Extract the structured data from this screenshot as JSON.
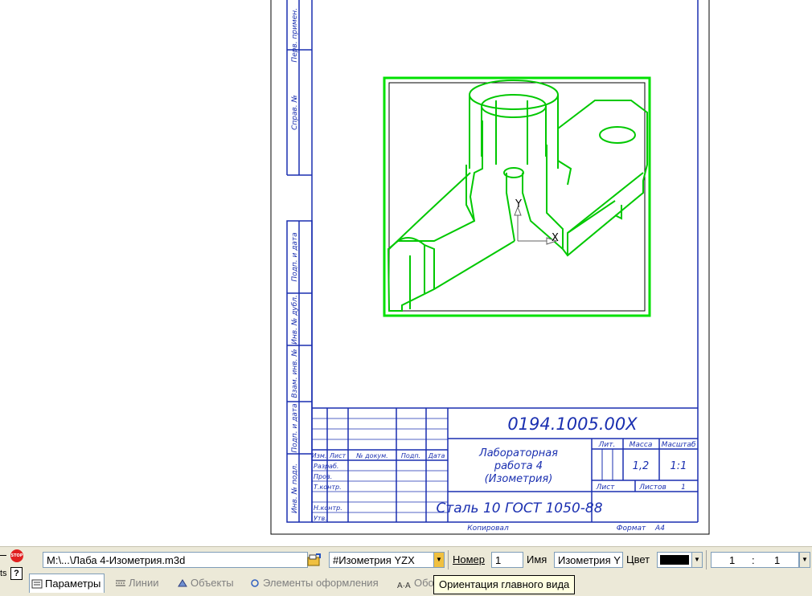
{
  "drawing": {
    "side_labels": [
      "Перв. примен.",
      "Справ. №",
      "Подп. и дата",
      "Инв. № дубл.",
      "Взам. инв. №",
      "Подп. и дата",
      "Инв. № подл."
    ],
    "designation": "0194.1005.00X",
    "title": [
      "Лабораторная",
      "работа 4",
      "(Изометрия)"
    ],
    "material": "Сталь 10  ГОСТ 1050-88",
    "col_headers": {
      "lit": "Лит.",
      "mass": "Масса",
      "scale": "Масштаб"
    },
    "mass_value": "1,2",
    "scale_value": "1:1",
    "sheet_label": "Лист",
    "sheets_label": "Листов",
    "sheets_value": "1",
    "row_header": [
      "Изм.",
      "Лист",
      "№ докум.",
      "Подп.",
      "Дата"
    ],
    "roles": [
      "Разраб.",
      "Пров.",
      "Т.контр.",
      "Н.контр.",
      "Утв."
    ],
    "copied": "Копировал",
    "format_label": "Формат",
    "format_value": "А4",
    "axis_y": "Y",
    "axis_x": "X",
    "colors": {
      "frame": "#1a2fb0",
      "view": "#00e000",
      "part": "#00c800"
    }
  },
  "panel": {
    "file_path": "M:\\...\\Лаба 4-Изометрия.m3d",
    "orientation": "#Изометрия YZX",
    "number_label": "Номер",
    "number_value": "1",
    "name_label": "Имя",
    "name_value": "Изометрия Y",
    "color_label": "Цвет",
    "color_value": "#000000",
    "scale_left": "1",
    "scale_sep": ":",
    "scale_right": "1",
    "tabs": [
      "Параметры",
      "Линии",
      "Объекты",
      "Элементы оформления",
      "Обо"
    ],
    "tooltip": "Ориентация главного вида",
    "left_text": "ts",
    "icons": [
      "stop-icon",
      "help-icon",
      "open-file-icon",
      "dropdown-arrow-icon"
    ]
  }
}
